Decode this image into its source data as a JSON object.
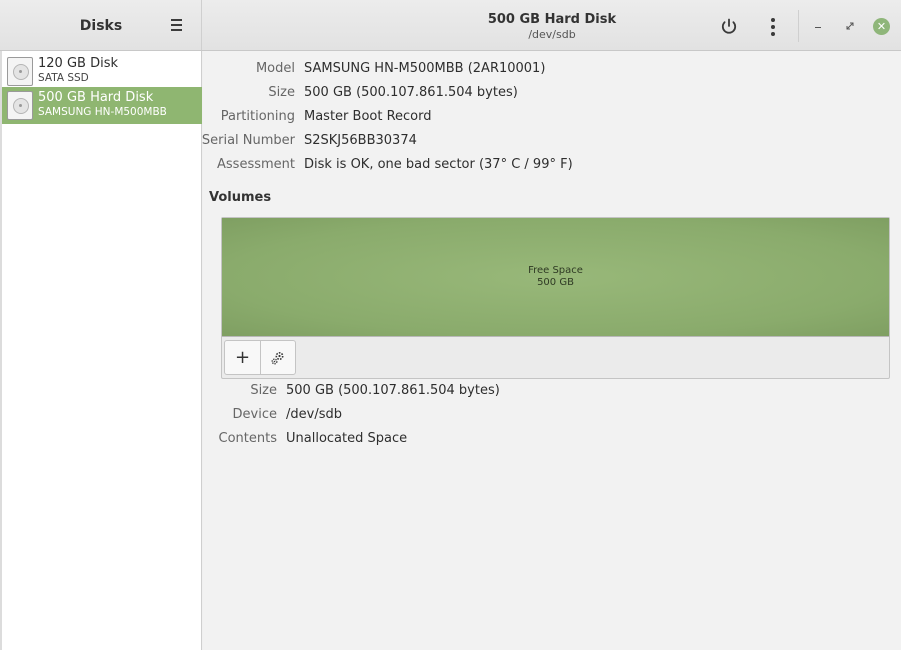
{
  "sidebar": {
    "title": "Disks",
    "menu_icon": "hamburger-menu-icon",
    "disks": [
      {
        "name": "120 GB Disk",
        "subtitle": "SATA SSD",
        "selected": false,
        "icon": "harddisk-icon"
      },
      {
        "name": "500 GB Hard Disk",
        "subtitle": "SAMSUNG HN-M500MBB",
        "selected": true,
        "icon": "harddisk-icon"
      }
    ]
  },
  "header": {
    "title": "500 GB Hard Disk",
    "subtitle": "/dev/sdb",
    "power_icon": "power-icon",
    "more_icon": "vertical-dots-icon",
    "window_controls": [
      "minimize-icon",
      "restore-icon",
      "close-icon"
    ],
    "close_color": "#8fb67a"
  },
  "drive": {
    "properties": [
      {
        "label": "Model",
        "value": "SAMSUNG HN-M500MBB (2AR10001)"
      },
      {
        "label": "Size",
        "value": "500 GB (500.107.861.504 bytes)"
      },
      {
        "label": "Partitioning",
        "value": "Master Boot Record"
      },
      {
        "label": "Serial Number",
        "value": "S2SKJ56BB30374"
      },
      {
        "label": "Assessment",
        "value": "Disk is OK, one bad sector (37° C / 99° F)"
      }
    ]
  },
  "volumes": {
    "heading": "Volumes",
    "segment": {
      "label": "Free Space",
      "size": "500 GB",
      "color": "#8fb671"
    },
    "add_button": "+",
    "gear_icon": "gears-icon",
    "properties": [
      {
        "label": "Size",
        "value": "500 GB (500.107.861.504 bytes)"
      },
      {
        "label": "Device",
        "value": "/dev/sdb"
      },
      {
        "label": "Contents",
        "value": "Unallocated Space"
      }
    ]
  },
  "colors": {
    "accent": "#8fb671",
    "sidebar_bg": "#ffffff",
    "main_bg": "#f2f2f2"
  }
}
